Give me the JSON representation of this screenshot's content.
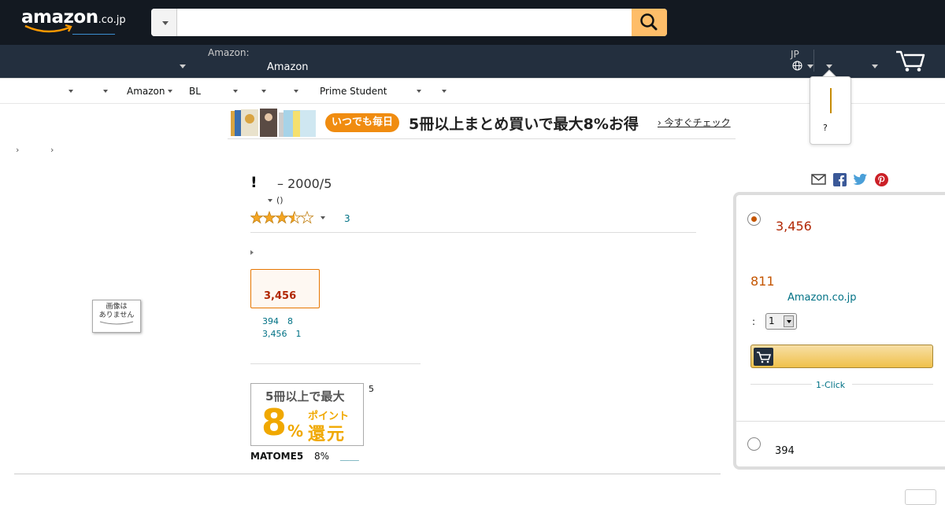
{
  "header": {
    "logo_text": "amazon",
    "logo_tld": ".co.jp",
    "search": {
      "placeholder": "",
      "value": ""
    },
    "deliver_line1": "Amazon:",
    "deliver_line2": "Amazon",
    "language": "JP",
    "popup_help": "?"
  },
  "nav": {
    "items": [
      "Amazon",
      "BL",
      "Prime Student"
    ]
  },
  "banner": {
    "pill": "いつでも毎日",
    "headline": "5冊以上まとめ買いで最大8%お得",
    "link": "› 今すぐチェック"
  },
  "breadcrumb": {
    "sep1": "›",
    "sep2": "›"
  },
  "product": {
    "no_image": "画像は\nありません",
    "title_bang": "!",
    "title": "– 2000/5",
    "author_paren": "()",
    "rating_stars": 3.5,
    "rating_count": "3",
    "format_price": "3,456",
    "other_offers": [
      "394　8",
      "3,456　1"
    ],
    "promo": {
      "line1": "5冊以上で最大",
      "digit": "8",
      "pct": "%",
      "point": "ポイント",
      "return": "還元"
    },
    "promo_side": "5",
    "promo_code": "MATOME5",
    "promo_pct": "8%",
    "promo_link": "＿＿"
  },
  "buybox": {
    "price": "3,456",
    "points": "811",
    "seller": "Amazon.co.jp",
    "qty_label": ":",
    "qty_value": "1",
    "oneclick": "1-Click",
    "used_price": "394"
  },
  "colors": {
    "header_bg": "#131921",
    "subheader_bg": "#232f3e",
    "search_button": "#febd69",
    "price_red": "#b12704",
    "link_teal": "#007185",
    "promo_orange": "#f0a800"
  }
}
